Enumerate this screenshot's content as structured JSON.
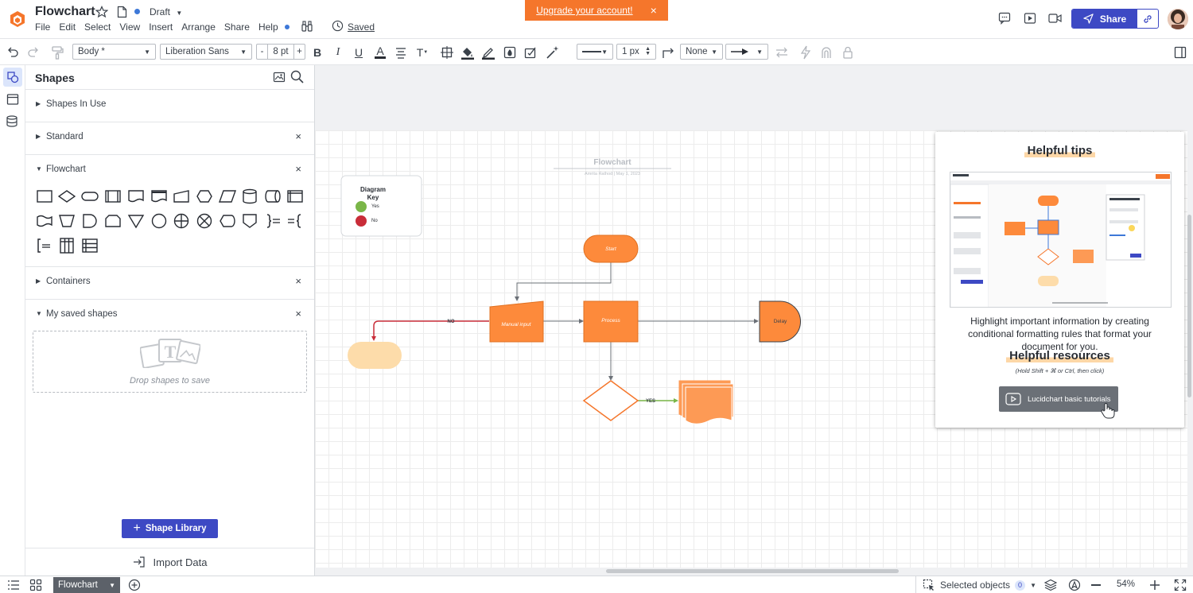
{
  "header": {
    "title": "Flowchart",
    "status": "Draft",
    "menu": [
      "File",
      "Edit",
      "Select",
      "View",
      "Insert",
      "Arrange",
      "Share",
      "Help"
    ],
    "saved": "Saved",
    "upgrade": "Upgrade your account!",
    "upgrade_close": "×",
    "share": "Share"
  },
  "toolbar": {
    "style": "Body *",
    "font": "Liberation Sans",
    "minus": "-",
    "font_size": "8 pt",
    "plus": "+",
    "bold": "B",
    "italic": "I",
    "underline": "U",
    "text_color": "A",
    "text_options": "T",
    "badge_count": "1",
    "line_width": "1 px",
    "endpoint_start": "None"
  },
  "shapes_panel": {
    "title": "Shapes",
    "sections": [
      {
        "label": "Shapes In Use",
        "closable": false
      },
      {
        "label": "Standard",
        "closable": true
      },
      {
        "label": "Flowchart",
        "closable": true
      },
      {
        "label": "Containers",
        "closable": true
      },
      {
        "label": "My saved shapes",
        "closable": true
      }
    ],
    "close_glyph": "×",
    "drop_text": "Drop shapes to save",
    "library_button": "Shape Library",
    "import": "Import Data"
  },
  "diagram": {
    "title": "Flowchart",
    "subtitle": "Amrita Rathod  |  May 1, 2023",
    "key_title_line1": "Diagram",
    "key_title_line2": "Key",
    "key_yes": "Yes",
    "key_no": "No",
    "start": "Start",
    "manual_input": "Manual input",
    "process": "Process",
    "delay": "Delay",
    "label_no": "NO",
    "label_yes": "YES"
  },
  "tips": {
    "title": "Helpful tips",
    "body": "Highlight important information by creating conditional formatting rules that format your document for you.",
    "resources_title": "Helpful resources",
    "note": "(Hold Shift + ⌘ or Ctrl, then click)",
    "button": "Lucidchart basic tutorials"
  },
  "bottom_bar": {
    "page_tab": "Flowchart",
    "selected_label": "Selected objects",
    "selected_count": "0",
    "zoom": "54%"
  },
  "colors": {
    "accent": "#3d49c4",
    "orange": "#f5762b",
    "shape_orange": "#fd8a3b",
    "green": "#7ab648",
    "red": "#c92d39"
  }
}
